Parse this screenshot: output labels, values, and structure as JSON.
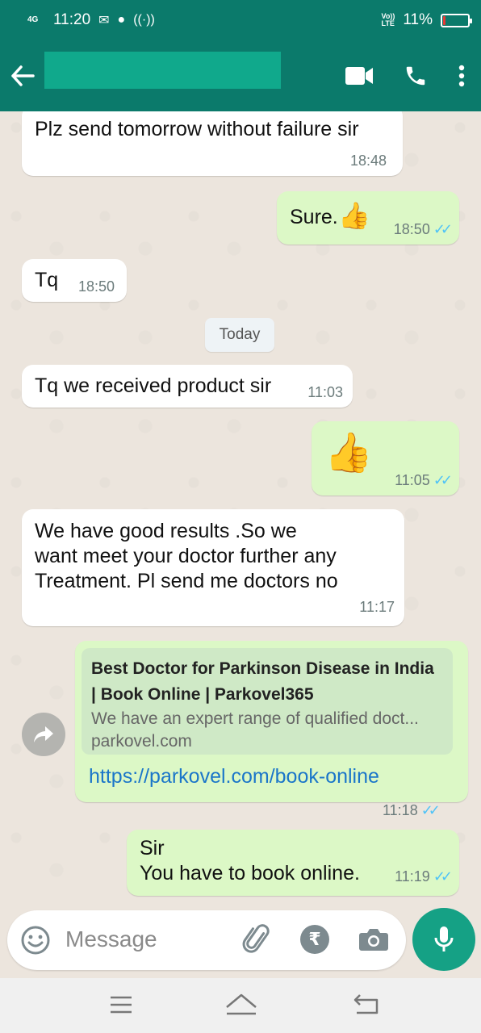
{
  "status_bar": {
    "network": "4G",
    "time": "11:20",
    "volte": "Vo))\nLTE",
    "battery_text": "11%",
    "battery_level": 0.11
  },
  "app_bar": {
    "icons": [
      "back-arrow-icon",
      "video-call-icon",
      "phone-icon",
      "more-vert-icon"
    ]
  },
  "messages": [
    {
      "direction": "incoming",
      "text": "Plz send tomorrow without failure sir",
      "time": "18:48"
    },
    {
      "direction": "outgoing",
      "text": "Sure.",
      "emoji": "👍",
      "time": "18:50",
      "ticks": "✓✓"
    },
    {
      "direction": "incoming",
      "text": "Tq",
      "time": "18:50"
    },
    {
      "direction": "incoming",
      "text": "Tq we received product sir",
      "time": "11:03"
    },
    {
      "direction": "outgoing",
      "emoji": "👍",
      "time": "11:05",
      "ticks": "✓✓"
    },
    {
      "direction": "incoming",
      "lines": [
        "We have good results .So we",
        "want meet your doctor further any",
        "Treatment. Pl send me doctors no"
      ],
      "time": "11:17"
    },
    {
      "direction": "outgoing",
      "link_preview": {
        "title_line1": "Best Doctor for Parkinson Disease in India",
        "title_line2": "| Book Online | Parkovel365",
        "description": "We have an expert range of qualified doct...",
        "domain": "parkovel.com"
      },
      "url": "https://parkovel.com/book-online",
      "time": "11:18",
      "ticks": "✓✓"
    },
    {
      "direction": "outgoing",
      "lines": [
        "Sir",
        "You have to book online."
      ],
      "time": "11:19",
      "ticks": "✓✓"
    }
  ],
  "date_divider": "Today",
  "composer": {
    "placeholder": "Message",
    "icons": [
      "emoji-icon",
      "attach-icon",
      "rupee-payment-icon",
      "camera-icon",
      "mic-icon"
    ]
  },
  "colors": {
    "header": "#0b7a6b",
    "outgoing_bubble": "#dcf8c6",
    "incoming_bubble": "#ffffff",
    "ticks": "#4fc3f7",
    "mic_button": "#15a185",
    "link": "#1b76c9"
  }
}
